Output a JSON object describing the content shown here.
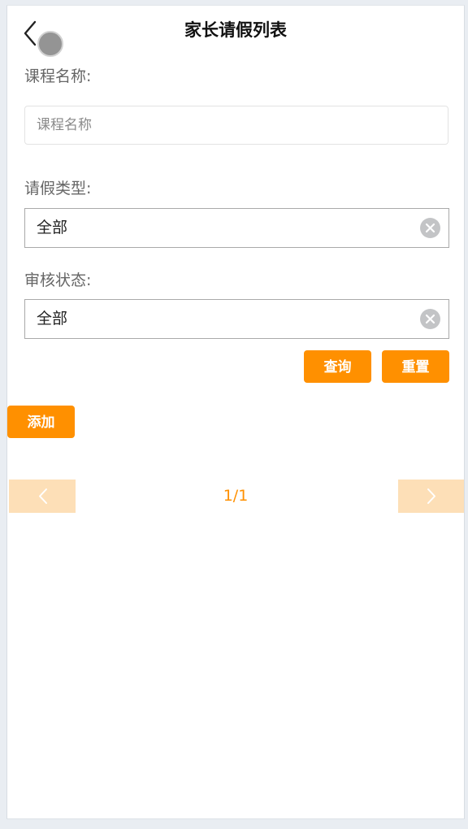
{
  "header": {
    "title": "家长请假列表",
    "back_icon": "chevron-left-icon"
  },
  "form": {
    "course_name": {
      "label": "课程名称:",
      "value": "",
      "placeholder": "课程名称"
    },
    "leave_type": {
      "label": "请假类型:",
      "selected": "全部",
      "clear_icon": "clear-circle-icon"
    },
    "review_status": {
      "label": "审核状态:",
      "selected": "全部",
      "clear_icon": "clear-circle-icon"
    }
  },
  "actions": {
    "query_label": "查询",
    "reset_label": "重置",
    "add_label": "添加"
  },
  "pager": {
    "page_text": "1/1",
    "prev_icon": "chevron-left-icon",
    "next_icon": "chevron-right-icon"
  },
  "colors": {
    "accent": "#ff9000",
    "pager_bg": "#fddfb7",
    "clear_icon_bg": "#c3c4c6"
  }
}
